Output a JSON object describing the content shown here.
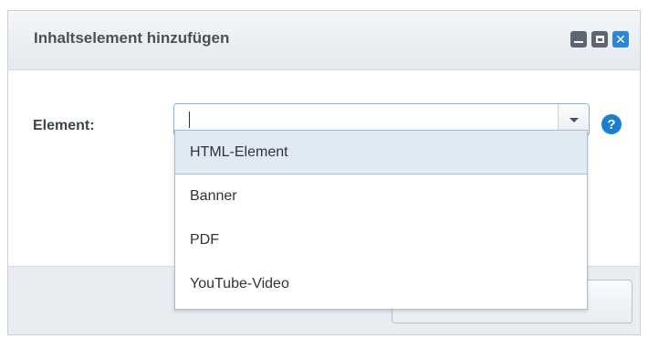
{
  "dialog": {
    "title": "Inhaltselement hinzufügen",
    "window_buttons": [
      "minimize-icon",
      "maximize-icon",
      "close-icon"
    ]
  },
  "form": {
    "element_label": "Element:",
    "element_value": "",
    "help_icon": "?"
  },
  "dropdown": {
    "items": [
      {
        "label": "HTML-Element",
        "highlighted": true
      },
      {
        "label": "Banner"
      },
      {
        "label": "PDF"
      },
      {
        "label": "YouTube-Video"
      }
    ]
  },
  "colors": {
    "accent": "#2a86d6",
    "help": "#1a7fd1",
    "highlight": "#dfeaf4"
  }
}
